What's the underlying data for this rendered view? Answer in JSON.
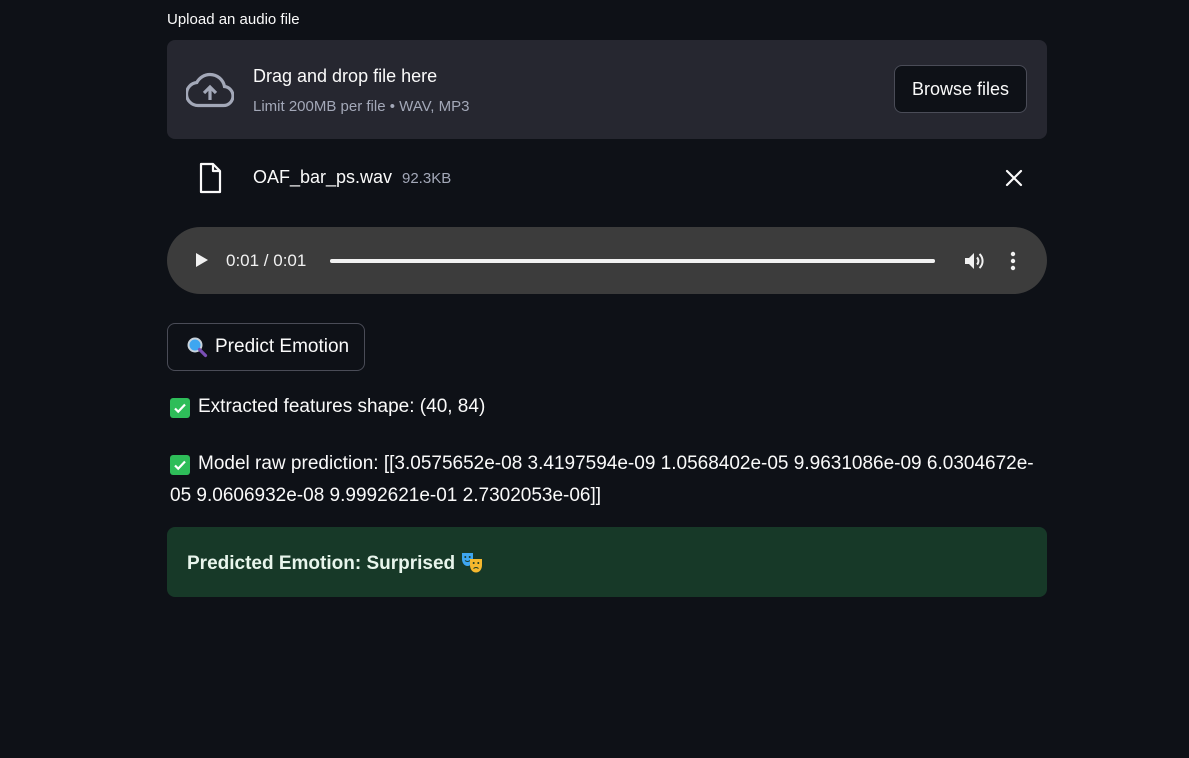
{
  "uploader": {
    "label": "Upload an audio file",
    "dropzone_title": "Drag and drop file here",
    "dropzone_subtitle": "Limit 200MB per file • WAV, MP3",
    "browse_label": "Browse files"
  },
  "file": {
    "name": "OAF_bar_ps.wav",
    "size": "92.3KB"
  },
  "audio": {
    "time": "0:01 / 0:01",
    "progress": 1.0
  },
  "predict_button": {
    "label": "Predict Emotion"
  },
  "messages": {
    "features": "Extracted features shape: (40, 84)",
    "raw_prediction": "Model raw prediction: [[3.0575652e-08 3.4197594e-09 1.0568402e-05 9.9631086e-09 6.0304672e-05 9.0606932e-08 9.9992621e-01 2.7302053e-06]]"
  },
  "result": {
    "text": "Predicted Emotion: Surprised"
  },
  "colors": {
    "background": "#0e1117",
    "surface": "#262730",
    "success_bg": "#173928",
    "check_green": "#2ebd59"
  },
  "icons": {
    "upload": "cloud-upload-icon",
    "file": "file-icon",
    "close": "close-icon",
    "play": "play-icon",
    "volume": "volume-icon",
    "more": "more-vert-icon",
    "predict": "magnifier-icon",
    "check": "check-icon",
    "result": "theater-masks-icon"
  }
}
